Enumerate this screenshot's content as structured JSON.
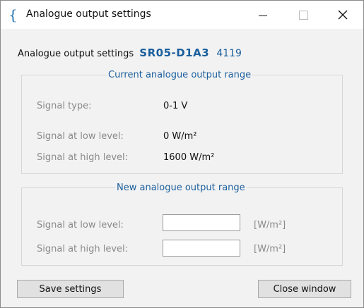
{
  "window": {
    "title": "Analogue output settings",
    "icon": "brace-logo-icon"
  },
  "header": {
    "label": "Analogue output settings",
    "model": "SR05-D1A3",
    "serial": "4119"
  },
  "current_range": {
    "legend": "Current analogue output range",
    "signal_type_label": "Signal type:",
    "signal_type_value": "0-1 V",
    "low_label": "Signal at low level:",
    "low_value": "0 W/m²",
    "high_label": "Signal at high level:",
    "high_value": "1600 W/m²"
  },
  "new_range": {
    "legend": "New analogue output range",
    "low_label": "Signal at low level:",
    "low_input": "",
    "low_unit": "[W/m²]",
    "high_label": "Signal at high level:",
    "high_input": "",
    "high_unit": "[W/m²]"
  },
  "buttons": {
    "save": "Save settings",
    "close": "Close window"
  },
  "colors": {
    "accent": "#1a5e9c",
    "muted_label": "#8a8a8a"
  }
}
